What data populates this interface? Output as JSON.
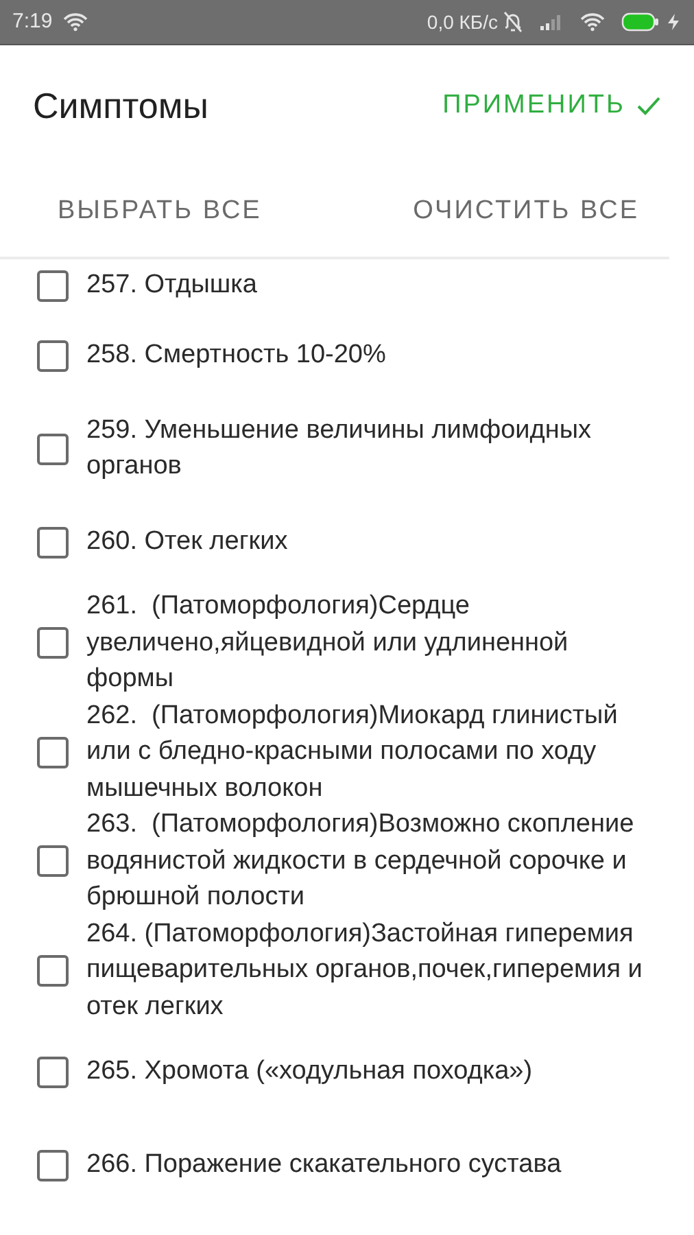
{
  "status_bar": {
    "time": "7:19",
    "speed": "0,0 КБ/с"
  },
  "header": {
    "title": "Симптомы",
    "apply": "ПРИМЕНИТЬ"
  },
  "actions": [
    {
      "label": "ВЫБРАТЬ ВСЕ"
    },
    {
      "label": "ОЧИСТИТЬ ВСЕ"
    }
  ],
  "symptoms": [
    {
      "text": "257. Отдышка",
      "checked": false
    },
    {
      "text": "258. Смертность 10-20%",
      "checked": false
    },
    {
      "text": "259. Уменьшение величины лимфоидных органов",
      "checked": false
    },
    {
      "text": "260. Отек легких",
      "checked": false
    },
    {
      "text": "261.  (Патоморфология)Сердце увеличено,яйцевидной или удлиненной формы",
      "checked": false
    },
    {
      "text": "262.  (Патоморфология)Миокард глинистый или с бледно-красными полосами по ходу мышечных волокон",
      "checked": false
    },
    {
      "text": "263.  (Патоморфология)Возможно скопление водянистой жидкости в сердечной сорочке и брюшной полости",
      "checked": false
    },
    {
      "text": "264. (Патоморфология)Застойная гиперемия пищеварительных органов,почек,гиперемия и отек легких",
      "checked": false
    },
    {
      "text": "265. Хромота («ходульная походка»)",
      "checked": false
    },
    {
      "text": "266. Поражение скакательного сустава",
      "checked": false
    }
  ]
}
